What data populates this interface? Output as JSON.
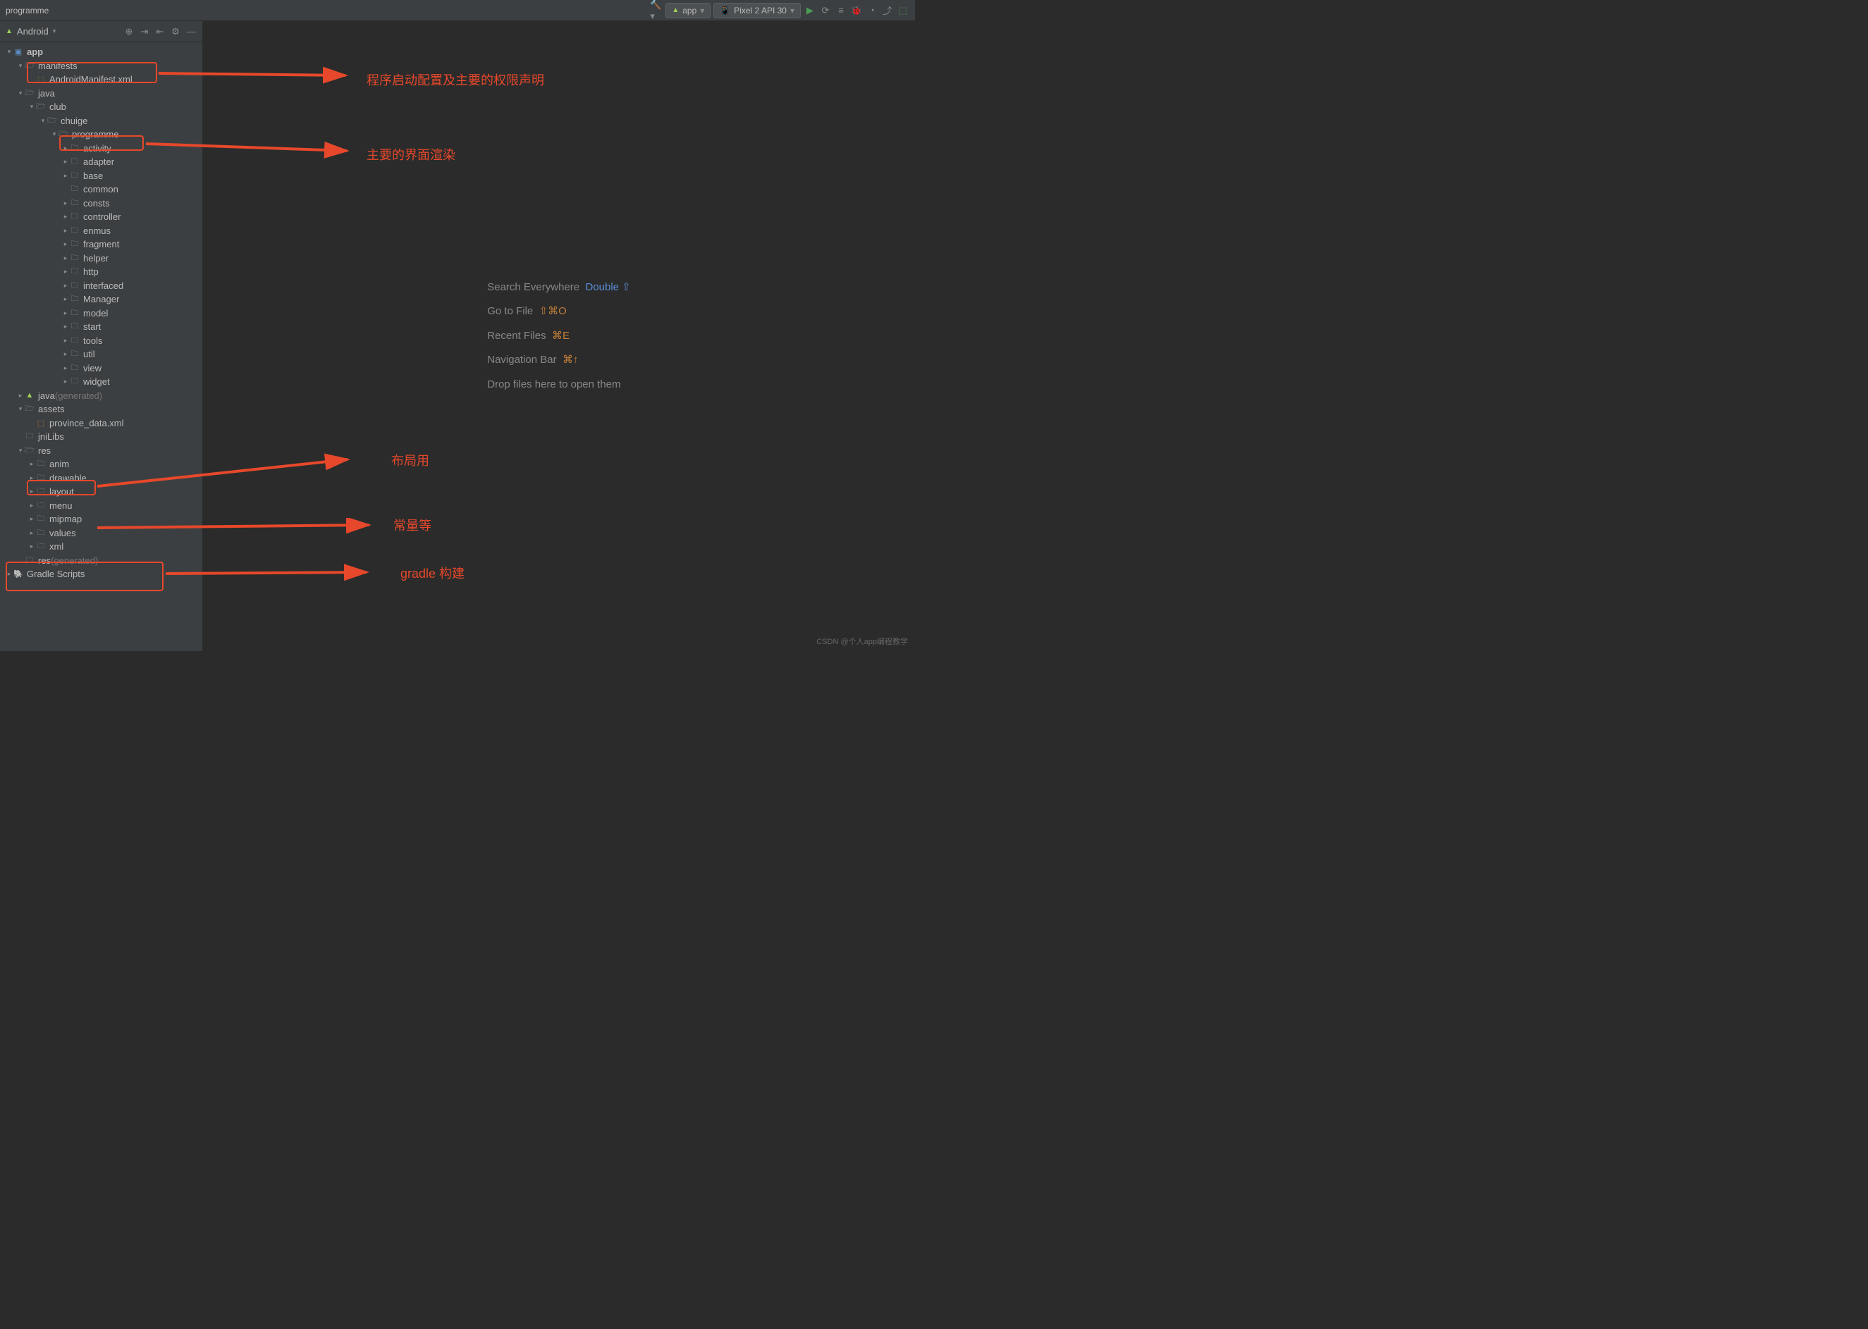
{
  "breadcrumb": "programme",
  "toolbar": {
    "config": "app",
    "device": "Pixel 2 API 30"
  },
  "sidebar": {
    "title": "Android",
    "tree": [
      {
        "d": 0,
        "a": "v",
        "i": "mod",
        "t": "app",
        "b": 1
      },
      {
        "d": 1,
        "a": "v",
        "i": "fold-o",
        "t": "manifests"
      },
      {
        "d": 2,
        "a": "",
        "i": "xml",
        "t": "AndroidManifest.xml"
      },
      {
        "d": 1,
        "a": "v",
        "i": "fold-o",
        "t": "java"
      },
      {
        "d": 2,
        "a": "v",
        "i": "fold-o",
        "t": "club"
      },
      {
        "d": 3,
        "a": "v",
        "i": "fold-o",
        "t": "chuige"
      },
      {
        "d": 4,
        "a": "v",
        "i": "fold-o",
        "t": "programme"
      },
      {
        "d": 5,
        "a": ">",
        "i": "fold",
        "t": "activity"
      },
      {
        "d": 5,
        "a": ">",
        "i": "fold",
        "t": "adapter"
      },
      {
        "d": 5,
        "a": ">",
        "i": "fold",
        "t": "base"
      },
      {
        "d": 5,
        "a": "",
        "i": "fold",
        "t": "common"
      },
      {
        "d": 5,
        "a": ">",
        "i": "fold",
        "t": "consts"
      },
      {
        "d": 5,
        "a": ">",
        "i": "fold",
        "t": "controller"
      },
      {
        "d": 5,
        "a": ">",
        "i": "fold",
        "t": "enmus"
      },
      {
        "d": 5,
        "a": ">",
        "i": "fold",
        "t": "fragment"
      },
      {
        "d": 5,
        "a": ">",
        "i": "fold",
        "t": "helper"
      },
      {
        "d": 5,
        "a": ">",
        "i": "fold",
        "t": "http"
      },
      {
        "d": 5,
        "a": ">",
        "i": "fold",
        "t": "interfaced"
      },
      {
        "d": 5,
        "a": ">",
        "i": "fold",
        "t": "Manager"
      },
      {
        "d": 5,
        "a": ">",
        "i": "fold",
        "t": "model"
      },
      {
        "d": 5,
        "a": ">",
        "i": "fold",
        "t": "start"
      },
      {
        "d": 5,
        "a": ">",
        "i": "fold",
        "t": "tools"
      },
      {
        "d": 5,
        "a": ">",
        "i": "fold",
        "t": "util"
      },
      {
        "d": 5,
        "a": ">",
        "i": "fold",
        "t": "view"
      },
      {
        "d": 5,
        "a": ">",
        "i": "fold",
        "t": "widget"
      },
      {
        "d": 1,
        "a": ">",
        "i": "and",
        "t": "java",
        "x": " (generated)"
      },
      {
        "d": 1,
        "a": "v",
        "i": "fold-o",
        "t": "assets"
      },
      {
        "d": 2,
        "a": "",
        "i": "xml2",
        "t": "province_data.xml"
      },
      {
        "d": 1,
        "a": "",
        "i": "fold",
        "t": "jniLibs"
      },
      {
        "d": 1,
        "a": "v",
        "i": "fold-o",
        "t": "res"
      },
      {
        "d": 2,
        "a": ">",
        "i": "fold",
        "t": "anim"
      },
      {
        "d": 2,
        "a": ">",
        "i": "fold",
        "t": "drawable"
      },
      {
        "d": 2,
        "a": ">",
        "i": "fold",
        "t": "layout"
      },
      {
        "d": 2,
        "a": ">",
        "i": "fold",
        "t": "menu"
      },
      {
        "d": 2,
        "a": ">",
        "i": "fold",
        "t": "mipmap"
      },
      {
        "d": 2,
        "a": ">",
        "i": "fold",
        "t": "values"
      },
      {
        "d": 2,
        "a": ">",
        "i": "fold",
        "t": "xml"
      },
      {
        "d": 1,
        "a": "",
        "i": "fold",
        "t": "res",
        "x": " (generated)"
      },
      {
        "d": 0,
        "a": ">",
        "i": "grd",
        "t": "Gradle Scripts"
      }
    ]
  },
  "welcome": {
    "l1a": "Search Everywhere",
    "l1b": "Double ⇧",
    "l2a": "Go to File",
    "l2b": "⇧⌘O",
    "l3a": "Recent Files",
    "l3b": "⌘E",
    "l4a": "Navigation Bar",
    "l4b": "⌘↑",
    "l5": "Drop files here to open them"
  },
  "annotations": {
    "a1": "程序启动配置及主要的权限声明",
    "a2": "主要的界面渲染",
    "a3": "布局用",
    "a4": "常量等",
    "a5": "gradle 构建"
  },
  "watermark": "CSDN @个人app编程教学"
}
